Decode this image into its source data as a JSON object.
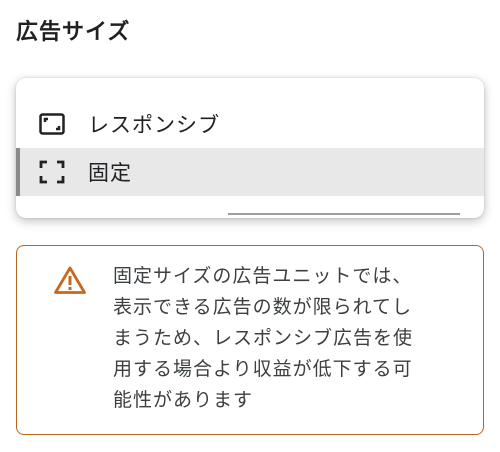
{
  "section": {
    "title": "広告サイズ"
  },
  "menu": {
    "options": [
      {
        "label": "レスポンシブ",
        "icon": "responsive-icon",
        "selected": false
      },
      {
        "label": "固定",
        "icon": "fixed-size-icon",
        "selected": true
      }
    ]
  },
  "warning": {
    "icon": "warning-icon",
    "lines": [
      "固定サイズの広告ユニットでは、",
      "表示できる広告の数が限られてし",
      "まうため、レスポンシブ広告を使",
      "用する場合より収益が低下する可",
      "能性があります"
    ]
  },
  "colors": {
    "warning_border": "#b8641c",
    "warning_icon": "#c5691e",
    "selected_bg": "#e8e8e8"
  }
}
